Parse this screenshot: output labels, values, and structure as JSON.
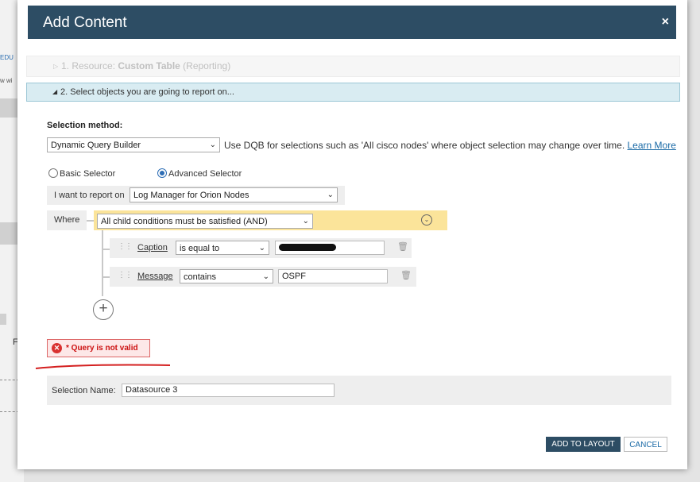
{
  "background": {
    "left_link_1": "EDU",
    "left_link_2": "w wi",
    "left_letter": "F"
  },
  "dialog": {
    "title": "Add Content",
    "close_glyph": "×"
  },
  "steps": {
    "step1_prefix": "1. Resource: ",
    "step1_name": "Custom Table",
    "step1_suffix": " (Reporting)",
    "step2_label": "2. Select objects you are going to report on..."
  },
  "selection": {
    "method_label": "Selection method:",
    "method_value": "Dynamic Query Builder",
    "hint_text": "Use DQB for selections such as 'All cisco nodes' where object selection may change over time.",
    "learn_more": "Learn More",
    "basic_selector": "Basic Selector",
    "advanced_selector": "Advanced Selector",
    "report_on_label": "I want to report on",
    "report_on_value": "Log Manager for Orion Nodes",
    "where_label": "Where",
    "logic_value": "All child conditions must be satisfied (AND)"
  },
  "conditions": [
    {
      "field": "Caption",
      "operator": "is equal to",
      "value": ""
    },
    {
      "field": "Message",
      "operator": "contains",
      "value": "OSPF"
    }
  ],
  "error": {
    "message": "* Query is not valid"
  },
  "selection_name": {
    "label": "Selection Name:",
    "value": "Datasource 3"
  },
  "buttons": {
    "add": "ADD TO LAYOUT",
    "cancel": "CANCEL"
  },
  "colors": {
    "header_bg": "#2d4d64",
    "step2_bg": "#d9ecf2",
    "logic_row_bg": "#fbe49a",
    "error_red": "#cc1111",
    "link_blue": "#1a6aa6"
  }
}
